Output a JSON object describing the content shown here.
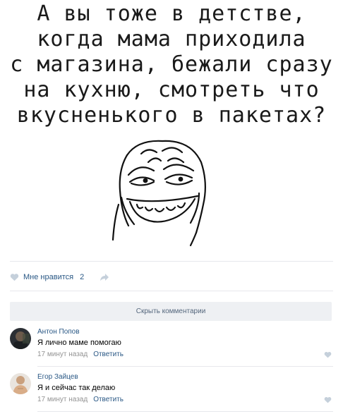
{
  "meme": {
    "lines": [
      "А вы тоже в детстве,",
      "когда мама приходила",
      "с магазина, бежали сразу",
      "на кухню, смотреть что",
      "вкусненького в пакетах?"
    ]
  },
  "likes": {
    "label": "Мне нравится",
    "count": "2"
  },
  "hide_comments_label": "Скрыть комментарии",
  "comments": [
    {
      "author": "Антон Попов",
      "text": "Я лично маме помогаю",
      "time": "17 минут назад",
      "reply": "Ответить"
    },
    {
      "author": "Егор Зайцев",
      "text": "Я и сейчас так делаю",
      "time": "17 минут назад",
      "reply": "Ответить"
    }
  ],
  "colors": {
    "link": "#2a5885",
    "muted": "#939393",
    "heart": "#c5d0db",
    "hide_bar_bg": "#eef0f3"
  }
}
